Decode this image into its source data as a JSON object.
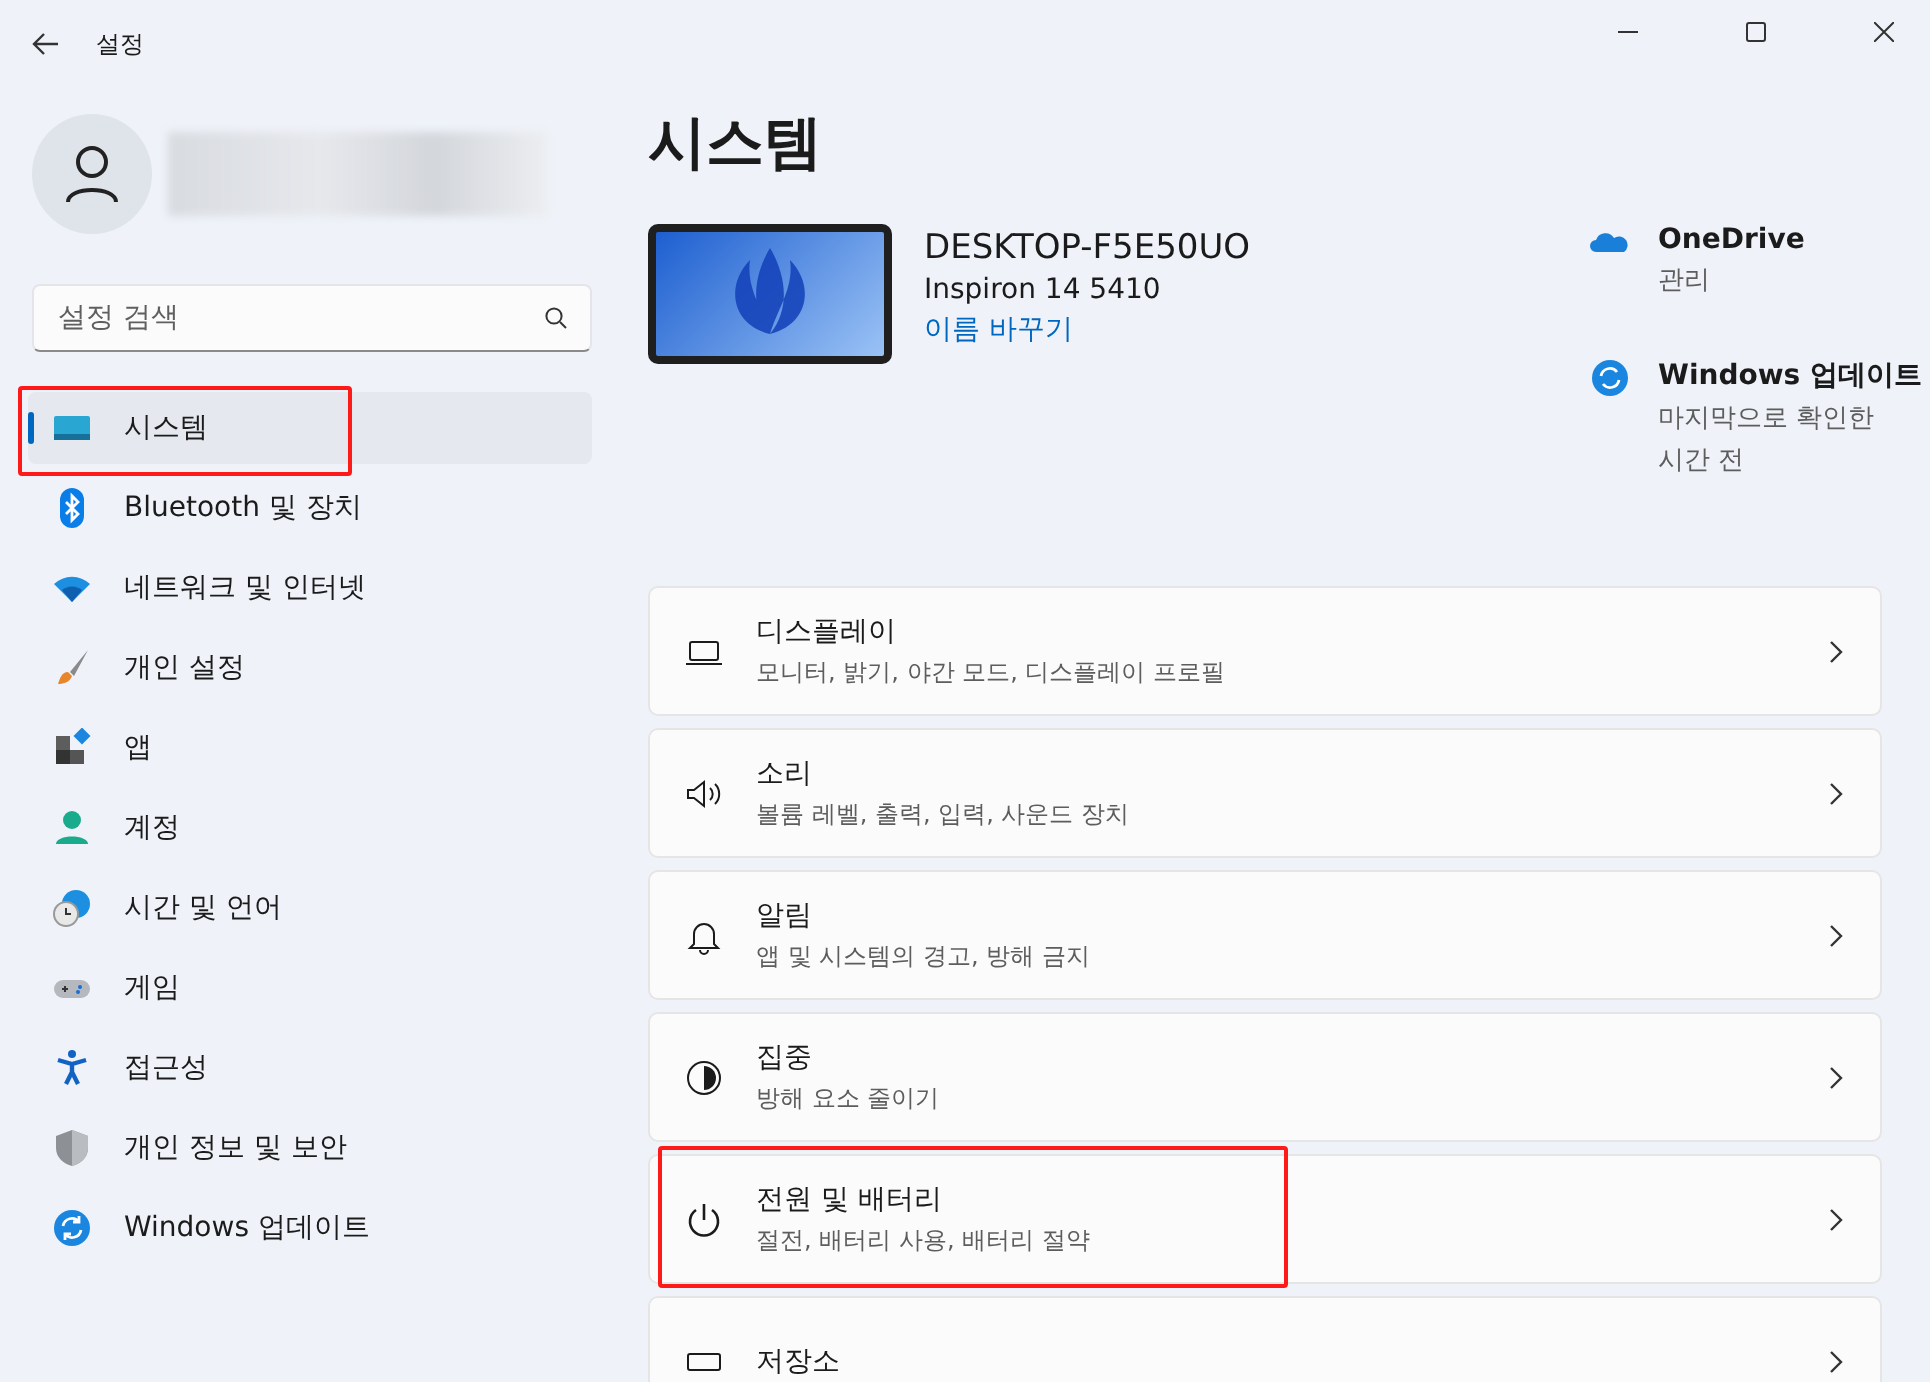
{
  "window": {
    "title": "설정"
  },
  "sidebar": {
    "search": {
      "placeholder": "설정 검색"
    },
    "items": [
      {
        "label": "시스템",
        "selected": true
      },
      {
        "label": "Bluetooth 및 장치",
        "selected": false
      },
      {
        "label": "네트워크 및 인터넷",
        "selected": false
      },
      {
        "label": "개인 설정",
        "selected": false
      },
      {
        "label": "앱",
        "selected": false
      },
      {
        "label": "계정",
        "selected": false
      },
      {
        "label": "시간 및 언어",
        "selected": false
      },
      {
        "label": "게임",
        "selected": false
      },
      {
        "label": "접근성",
        "selected": false
      },
      {
        "label": "개인 정보 및 보안",
        "selected": false
      },
      {
        "label": "Windows 업데이트",
        "selected": false
      }
    ]
  },
  "page": {
    "title": "시스템"
  },
  "device": {
    "name": "DESKTOP-F5E50UO",
    "model": "Inspiron 14 5410",
    "rename_link": "이름 바꾸기"
  },
  "services": [
    {
      "title": "OneDrive",
      "lines": [
        "관리"
      ]
    },
    {
      "title": "Windows 업데이트",
      "lines": [
        "마지막으로 확인한",
        "시간 전"
      ]
    }
  ],
  "settings": [
    {
      "title": "디스플레이",
      "subtitle": "모니터, 밝기, 야간 모드, 디스플레이 프로필"
    },
    {
      "title": "소리",
      "subtitle": "볼륨 레벨, 출력, 입력, 사운드 장치"
    },
    {
      "title": "알림",
      "subtitle": "앱 및 시스템의 경고, 방해 금지"
    },
    {
      "title": "집중",
      "subtitle": "방해 요소 줄이기"
    },
    {
      "title": "전원 및 배터리",
      "subtitle": "절전, 배터리 사용, 배터리 절약"
    },
    {
      "title": "저장소"
    }
  ]
}
